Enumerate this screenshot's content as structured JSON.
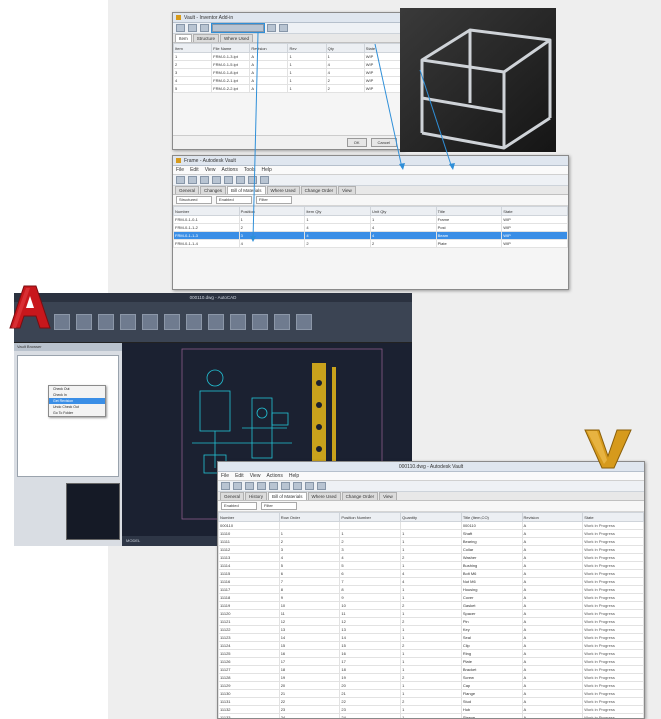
{
  "colors": {
    "accent": "#3a8ee6",
    "autocad_red": "#c8171c",
    "vault_gold": "#d69a1c",
    "dark_ui": "#1e2430"
  },
  "win1": {
    "title": "Vault - Inventor Add-in",
    "tabs": [
      "Item",
      "Structure",
      "Where Used"
    ],
    "columns": [
      "Item",
      "File Name",
      "Revision",
      "Rev",
      "Qty",
      "State"
    ],
    "rows": [
      [
        "1",
        "FRM-0-1-3.ipt",
        "A",
        "1",
        "1",
        "WIP"
      ],
      [
        "2",
        "FRM-0-1-5.ipt",
        "A",
        "1",
        "4",
        "WIP"
      ],
      [
        "3",
        "FRM-0-1-8.ipt",
        "A",
        "1",
        "4",
        "WIP"
      ],
      [
        "4",
        "FRM-0-2-1.ipt",
        "A",
        "1",
        "2",
        "WIP"
      ],
      [
        "5",
        "FRM-0-2-2.ipt",
        "A",
        "1",
        "2",
        "WIP"
      ]
    ],
    "buttons": [
      "OK",
      "Cancel"
    ]
  },
  "win2": {
    "title": "Frame - Autodesk Vault",
    "menu": [
      "File",
      "Edit",
      "View",
      "Actions",
      "Tools",
      "Help"
    ],
    "tabs": [
      "General",
      "Changes",
      "Bill of Materials",
      "Where Used",
      "Change Order",
      "View"
    ],
    "filters": [
      "Structured",
      "Enabled",
      "Filter"
    ],
    "columns": [
      "Number",
      "Position",
      "Item Qty",
      "Unit Qty",
      "Title",
      "State"
    ],
    "rows": [
      [
        "FRM-0-1-0-1",
        "1",
        "1",
        "1",
        "Frame",
        "WIP"
      ],
      [
        "FRM-0-1-1-2",
        "2",
        "4",
        "4",
        "Post",
        "WIP"
      ],
      [
        "FRM-0-1-1-3",
        "3",
        "4",
        "4",
        "Beam",
        "WIP"
      ],
      [
        "FRM-0-1-1-4",
        "4",
        "2",
        "2",
        "Plate",
        "WIP"
      ]
    ],
    "selected_row": 2
  },
  "acad": {
    "title": "000110.dwg - AutoCAD",
    "status": "MODEL",
    "panel_title": "Vault Browser",
    "menu": [
      "Check Out",
      "Check In",
      "Get Revision",
      "Undo Check Out",
      "Go To Folder"
    ],
    "highlighted_menu": 2
  },
  "vapp": {
    "title": "000110.dwg - Autodesk Vault",
    "menu": [
      "File",
      "Edit",
      "View",
      "Actions",
      "Help"
    ],
    "tabs": [
      "General",
      "History",
      "Bill of Materials",
      "Where Used",
      "Change Order",
      "View"
    ],
    "filters": [
      "Enabled",
      "Filter"
    ],
    "columns": [
      "Number",
      "Row Order",
      "Position Number",
      "Quantity",
      "Title (Item,CO)",
      "Revision",
      "State"
    ],
    "rows": [
      [
        "000110",
        "",
        "",
        "",
        "000110",
        "A",
        "Work in Progress"
      ],
      [
        "11110",
        "1",
        "1",
        "1",
        "Shaft",
        "A",
        "Work in Progress"
      ],
      [
        "11111",
        "2",
        "2",
        "1",
        "Bearing",
        "A",
        "Work in Progress"
      ],
      [
        "11112",
        "3",
        "3",
        "1",
        "Collar",
        "A",
        "Work in Progress"
      ],
      [
        "11113",
        "4",
        "4",
        "2",
        "Washer",
        "A",
        "Work in Progress"
      ],
      [
        "11114",
        "5",
        "5",
        "1",
        "Bushing",
        "A",
        "Work in Progress"
      ],
      [
        "11115",
        "6",
        "6",
        "4",
        "Bolt M6",
        "A",
        "Work in Progress"
      ],
      [
        "11116",
        "7",
        "7",
        "4",
        "Nut M6",
        "A",
        "Work in Progress"
      ],
      [
        "11117",
        "8",
        "8",
        "1",
        "Housing",
        "A",
        "Work in Progress"
      ],
      [
        "11118",
        "9",
        "9",
        "1",
        "Cover",
        "A",
        "Work in Progress"
      ],
      [
        "11119",
        "10",
        "10",
        "2",
        "Gasket",
        "A",
        "Work in Progress"
      ],
      [
        "11120",
        "11",
        "11",
        "1",
        "Spacer",
        "A",
        "Work in Progress"
      ],
      [
        "11121",
        "12",
        "12",
        "2",
        "Pin",
        "A",
        "Work in Progress"
      ],
      [
        "11122",
        "13",
        "13",
        "1",
        "Key",
        "A",
        "Work in Progress"
      ],
      [
        "11123",
        "14",
        "14",
        "1",
        "Seal",
        "A",
        "Work in Progress"
      ],
      [
        "11124",
        "15",
        "15",
        "2",
        "Clip",
        "A",
        "Work in Progress"
      ],
      [
        "11125",
        "16",
        "16",
        "1",
        "Ring",
        "A",
        "Work in Progress"
      ],
      [
        "11126",
        "17",
        "17",
        "1",
        "Plate",
        "A",
        "Work in Progress"
      ],
      [
        "11127",
        "18",
        "18",
        "1",
        "Bracket",
        "A",
        "Work in Progress"
      ],
      [
        "11128",
        "19",
        "19",
        "2",
        "Screw",
        "A",
        "Work in Progress"
      ],
      [
        "11129",
        "20",
        "20",
        "1",
        "Cap",
        "A",
        "Work in Progress"
      ],
      [
        "11130",
        "21",
        "21",
        "1",
        "Flange",
        "A",
        "Work in Progress"
      ],
      [
        "11131",
        "22",
        "22",
        "2",
        "Stud",
        "A",
        "Work in Progress"
      ],
      [
        "11132",
        "23",
        "23",
        "1",
        "Hub",
        "A",
        "Work in Progress"
      ],
      [
        "11133",
        "24",
        "24",
        "1",
        "Sleeve",
        "A",
        "Work in Progress"
      ]
    ]
  }
}
